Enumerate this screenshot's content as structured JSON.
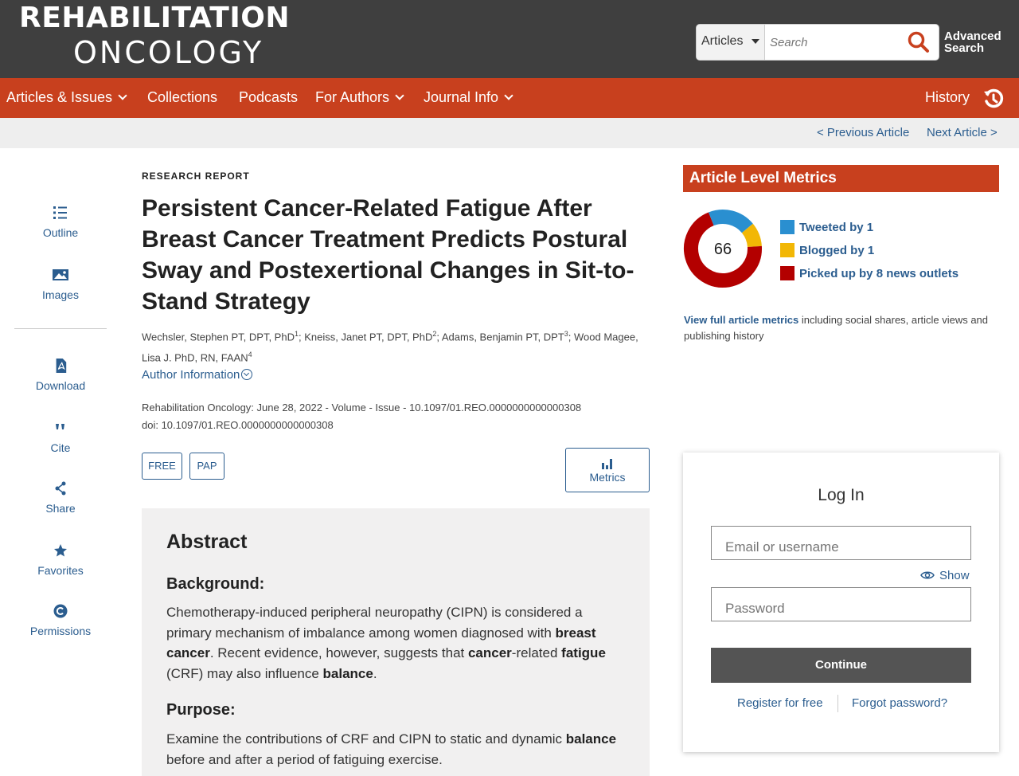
{
  "header": {
    "logo_line1": "REHABILITATION",
    "logo_line2": "ONCOLOGY",
    "search_scope": "Articles",
    "search_placeholder": "Search",
    "advanced_line1": "Advanced",
    "advanced_line2": "Search"
  },
  "nav": {
    "items": [
      {
        "label": "Articles & Issues",
        "has_dropdown": true
      },
      {
        "label": "Collections",
        "has_dropdown": false
      },
      {
        "label": "Podcasts",
        "has_dropdown": false
      },
      {
        "label": "For Authors",
        "has_dropdown": true
      },
      {
        "label": "Journal Info",
        "has_dropdown": true
      }
    ],
    "history": "History"
  },
  "article_nav": {
    "previous": "< Previous Article",
    "next": "Next Article >"
  },
  "rail": {
    "items": [
      {
        "label": "Outline",
        "icon": "list-icon"
      },
      {
        "label": "Images",
        "icon": "image-icon"
      },
      {
        "label": "Download",
        "icon": "pdf-icon"
      },
      {
        "label": "Cite",
        "icon": "quote-icon"
      },
      {
        "label": "Share",
        "icon": "share-icon"
      },
      {
        "label": "Favorites",
        "icon": "star-icon"
      },
      {
        "label": "Permissions",
        "icon": "copyright-icon"
      }
    ]
  },
  "article": {
    "type": "RESEARCH REPORT",
    "title": "Persistent Cancer-Related Fatigue After Breast Cancer Treatment Predicts Postural Sway and Postexertional Changes in Sit-to-Stand Strategy",
    "authors": [
      {
        "name": "Wechsler, Stephen PT, DPT, PhD",
        "sup": "1",
        "sep": "; "
      },
      {
        "name": "Kneiss, Janet PT, DPT, PhD",
        "sup": "2",
        "sep": "; "
      },
      {
        "name": "Adams, Benjamin PT, DPT",
        "sup": "3",
        "sep": "; "
      },
      {
        "name": "Wood Magee, Lisa J. PhD, RN, FAAN",
        "sup": "4",
        "sep": ""
      }
    ],
    "author_info": "Author Information",
    "citation": "Rehabilitation Oncology: June 28, 2022 - Volume - Issue - 10.1097/01.REO.0000000000000308",
    "doi": "doi: 10.1097/01.REO.0000000000000308",
    "badge_free": "FREE",
    "badge_pap": "PAP",
    "metrics_button": "Metrics"
  },
  "abstract": {
    "heading": "Abstract",
    "background_heading": "Background:",
    "background_html": "Chemotherapy-induced peripheral neuropathy (CIPN) is considered a primary mechanism of imbalance among women diagnosed with <b>breast cancer</b>. Recent evidence, however, suggests that <b>cancer</b>-related <b>fatigue</b> (CRF) may also influence <b>balance</b>.",
    "purpose_heading": "Purpose:",
    "purpose_html": "Examine the contributions of CRF and CIPN to static and dynamic <b>balance</b> before and after a period of fatiguing exercise."
  },
  "metrics": {
    "heading": "Article Level Metrics",
    "score": "66",
    "legend": [
      {
        "label": "Tweeted by 1",
        "color": "#2a8fd0"
      },
      {
        "label": "Blogged by 1",
        "color": "#f2b705"
      },
      {
        "label": "Picked up by 8 news outlets",
        "color": "#b30000"
      }
    ],
    "ring_fractions": [
      0.2,
      0.1,
      0.7
    ],
    "full_link": "View full article metrics",
    "full_text": " including social shares, article views and publishing history"
  },
  "login": {
    "heading": "Log In",
    "email_placeholder": "Email or username",
    "show": "Show",
    "password_placeholder": "Password",
    "continue": "Continue",
    "register": "Register for free",
    "forgot": "Forgot password?"
  }
}
